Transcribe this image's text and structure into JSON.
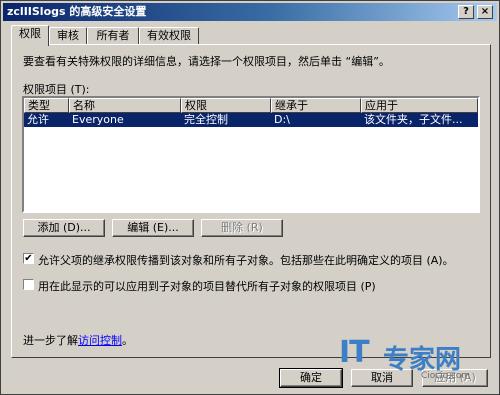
{
  "window": {
    "title": "zclIISlogs 的高级安全设置",
    "help_glyph": "?",
    "close_glyph": "×"
  },
  "tabs": [
    {
      "label": "权限"
    },
    {
      "label": "审核"
    },
    {
      "label": "所有者"
    },
    {
      "label": "有效权限"
    }
  ],
  "description": "要查看有关特殊权限的详细信息，请选择一个权限项目，然后单击 “编辑”。",
  "list": {
    "caption": "权限项目 (T):",
    "columns": [
      "类型",
      "名称",
      "权限",
      "继承于",
      "应用于"
    ],
    "rows": [
      {
        "type": "允许",
        "name": "Everyone",
        "permission": "完全控制",
        "inherited_from": "D:\\",
        "applies_to": "该文件夹，子文件..."
      }
    ]
  },
  "buttons": {
    "add": "添加 (D)...",
    "edit": "编辑 (E)...",
    "remove": "删除 (R)",
    "ok": "确定",
    "cancel": "取消",
    "apply": "应用 (A)"
  },
  "options": {
    "inherit": {
      "checked": true,
      "mark": "✔",
      "label": "允许父项的继承权限传播到该对象和所有子对象。包括那些在此明确定义的项目 (A)。"
    },
    "replace": {
      "checked": false,
      "mark": "",
      "label": "用在此显示的可以应用到子对象的项目替代所有子对象的权限项目 (P)"
    }
  },
  "footer": {
    "learn_prefix": "进一步了解",
    "learn_link": "访问控制",
    "learn_suffix": "。"
  },
  "watermark": {
    "brand_it": "IT",
    "brand_rest": "专家网",
    "domain": "Ciocio.com"
  },
  "colors": {
    "title_active": "#0a246a",
    "selection": "#0a246a",
    "dialog_face": "#d4d0c8",
    "link": "#0000ff",
    "watermark": "#3d7fc6"
  }
}
